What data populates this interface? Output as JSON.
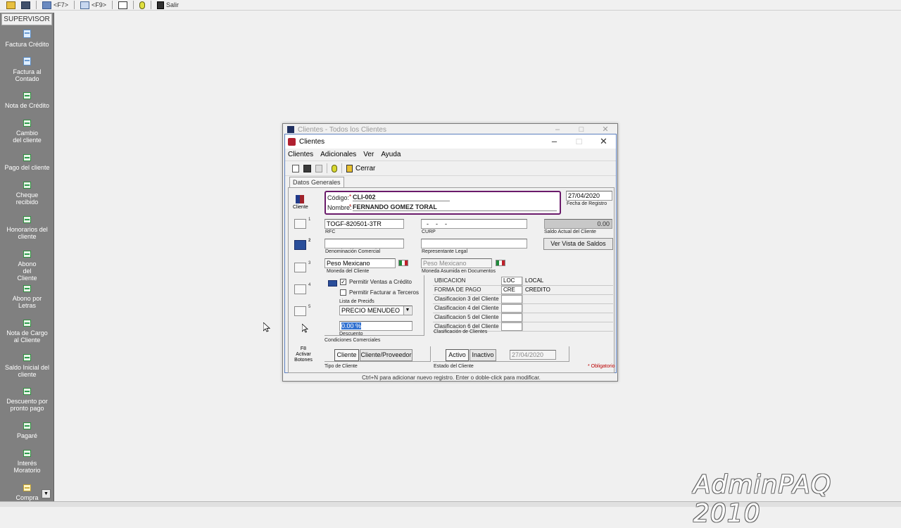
{
  "toolbar": {
    "items": [
      {
        "icon": "folder-open-icon",
        "label": ""
      },
      {
        "icon": "save-icon",
        "label": ""
      },
      {
        "icon": "tools-icon",
        "label": "<F7>"
      },
      {
        "icon": "search-icon",
        "label": "<F9>"
      },
      {
        "icon": "calendar-icon",
        "label": ""
      },
      {
        "icon": "help-icon",
        "label": ""
      },
      {
        "icon": "exit-icon",
        "label": "Salir"
      }
    ]
  },
  "sidebar": {
    "title": "SUPERVISOR",
    "items": [
      {
        "label": "Factura Crédito",
        "icon": "document-icon"
      },
      {
        "label": "Factura al Contado",
        "icon": "document-icon"
      },
      {
        "label": "Nota de Crédito",
        "icon": "note-icon"
      },
      {
        "label": "Cambio del cliente",
        "icon": "note-icon"
      },
      {
        "label": "Pago del cliente",
        "icon": "note-icon"
      },
      {
        "label": "Cheque recibido",
        "icon": "note-icon"
      },
      {
        "label": "Honorarios del cliente",
        "icon": "note-icon"
      },
      {
        "label": "Abono del Cliente",
        "icon": "note-icon"
      },
      {
        "label": "Abono por Letras",
        "icon": "note-icon"
      },
      {
        "label": "Nota de Cargo al Cliente",
        "icon": "note-icon"
      },
      {
        "label": "Saldo Inicial del cliente",
        "icon": "note-icon"
      },
      {
        "label": "Descuento por pronto pago",
        "icon": "note-icon"
      },
      {
        "label": "Pagaré",
        "icon": "note-icon"
      },
      {
        "label": "Interés Moratorio",
        "icon": "note-icon"
      },
      {
        "label": "Compra",
        "icon": "purchase-icon"
      }
    ]
  },
  "bg_window": {
    "title": "Clientes - Todos los Clientes"
  },
  "dialog": {
    "title": "Clientes",
    "menu": [
      "Clientes",
      "Adicionales",
      "Ver",
      "Ayuda"
    ],
    "toolbar_close": "Cerrar",
    "tab": "Datos Generales",
    "left_icons": {
      "cliente_label": "Cliente",
      "f8_label": "F8\nActivar\nBotones"
    },
    "codigo_label": "Código:",
    "codigo_value": "CLI-002",
    "nombre_label": "Nombre:",
    "nombre_value": "FERNANDO GOMEZ TORAL",
    "fecha_value": "27/04/2020",
    "fecha_label": "Fecha de Registro",
    "rfc_value": "TOGF-820501-3TR",
    "rfc_label": "RFC",
    "curp_value": "  -    -    -  ",
    "curp_label": "CURP",
    "saldo_value": "0.00",
    "saldo_label": "Saldo Actual del Cliente",
    "denominacion_label": "Denominación Comercial",
    "representante_label": "Representante Legal",
    "ver_saldos_button": "Ver Vista de Saldos",
    "moneda_value": "Peso Mexicano",
    "moneda_label": "Moneda del Cliente",
    "moneda_doc_value": "Peso Mexicano",
    "moneda_doc_label": "Moneda Asumida en Documentos",
    "permitir_credito": "Permitir Ventas a Crédito",
    "permitir_terceros": "Permitir Facturar a Terceros",
    "lista_precios_label": "Lista de Precios",
    "lista_precios_value": "PRECIO MENUDEO",
    "descuento_value": "0.00 %",
    "descuento_label": "Descuento",
    "condiciones_label": "Condiciones Comerciales",
    "clasificacion_label": "Clasificación de Clientes",
    "classifications": [
      {
        "name": "UBICACION",
        "code": "LOC",
        "desc": "LOCAL"
      },
      {
        "name": "FORMA DE PAGO",
        "code": "CRE",
        "desc": "CREDITO"
      },
      {
        "name": "Clasificacion 3 del Cliente",
        "code": "",
        "desc": ""
      },
      {
        "name": "Clasificacion 4 del Cliente",
        "code": "",
        "desc": ""
      },
      {
        "name": "Clasificacion 5 del Cliente",
        "code": "",
        "desc": ""
      },
      {
        "name": "Clasificacion 6 del Cliente",
        "code": "",
        "desc": ""
      }
    ],
    "tipo_cliente_btn": "Cliente",
    "tipo_proveedor_btn": "Cliente/Proveedor",
    "tipo_label": "Tipo de Cliente",
    "estado_activo_btn": "Activo",
    "estado_inactivo_btn": "Inactivo",
    "estado_fecha": "27/04/2020",
    "estado_label": "Estado del Cliente",
    "obligatorio_label": "* Obligatorio",
    "status_line": "Ctrl+N para adicionar nuevo registro. Enter o doble-click para modificar."
  },
  "watermark": "AdminPAQ 2010",
  "colors": {
    "sidebar_bg": "#808080",
    "code_box_border": "#6a1a6a",
    "dialog_border": "#5b7fbf"
  }
}
